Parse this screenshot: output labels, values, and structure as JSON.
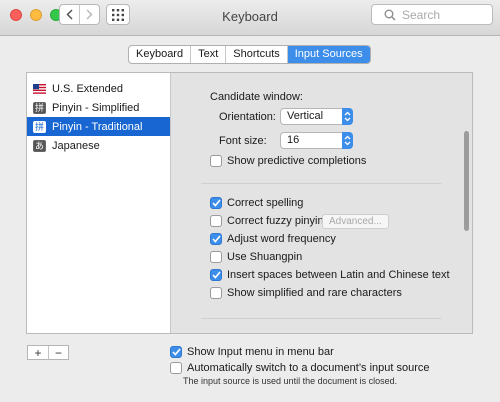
{
  "window": {
    "title": "Keyboard"
  },
  "search": {
    "placeholder": "Search"
  },
  "tabs": [
    {
      "label": "Keyboard",
      "active": false
    },
    {
      "label": "Text",
      "active": false
    },
    {
      "label": "Shortcuts",
      "active": false
    },
    {
      "label": "Input Sources",
      "active": true
    }
  ],
  "input_sources": [
    {
      "label": "U.S. Extended",
      "icon": "us-flag-icon",
      "selected": false
    },
    {
      "label": "Pinyin - Simplified",
      "icon": "pinyin-simplified-icon",
      "icon_glyph": "拼",
      "selected": false
    },
    {
      "label": "Pinyin - Traditional",
      "icon": "pinyin-traditional-icon",
      "icon_glyph": "拼",
      "selected": true
    },
    {
      "label": "Japanese",
      "icon": "japanese-icon",
      "icon_glyph": "あ",
      "selected": false
    }
  ],
  "candidate": {
    "heading": "Candidate window:",
    "orientation_label": "Orientation:",
    "orientation_value": "Vertical",
    "font_size_label": "Font size:",
    "font_size_value": "16",
    "predictive": {
      "label": "Show predictive completions",
      "checked": false
    }
  },
  "options": {
    "correct_spelling": {
      "label": "Correct spelling",
      "checked": true
    },
    "correct_fuzzy": {
      "label": "Correct fuzzy pinyin",
      "checked": false
    },
    "advanced_label": "Advanced...",
    "adjust_word_frequency": {
      "label": "Adjust word frequency",
      "checked": true
    },
    "use_shuangpin": {
      "label": "Use Shuangpin",
      "checked": false
    },
    "insert_spaces": {
      "label": "Insert spaces between Latin and Chinese text",
      "checked": true
    },
    "show_simplified_rare": {
      "label": "Show simplified and rare characters",
      "checked": false
    }
  },
  "list_controls": {
    "add": "+",
    "remove": "−"
  },
  "bottom": {
    "show_input_menu": {
      "label": "Show Input menu in menu bar",
      "checked": true
    },
    "auto_switch": {
      "label": "Automatically switch to a document’s input source",
      "checked": false
    },
    "note": "The input source is used until the document is closed."
  },
  "colors": {
    "accent": "#3d8eeb",
    "selection": "#1866d1"
  }
}
